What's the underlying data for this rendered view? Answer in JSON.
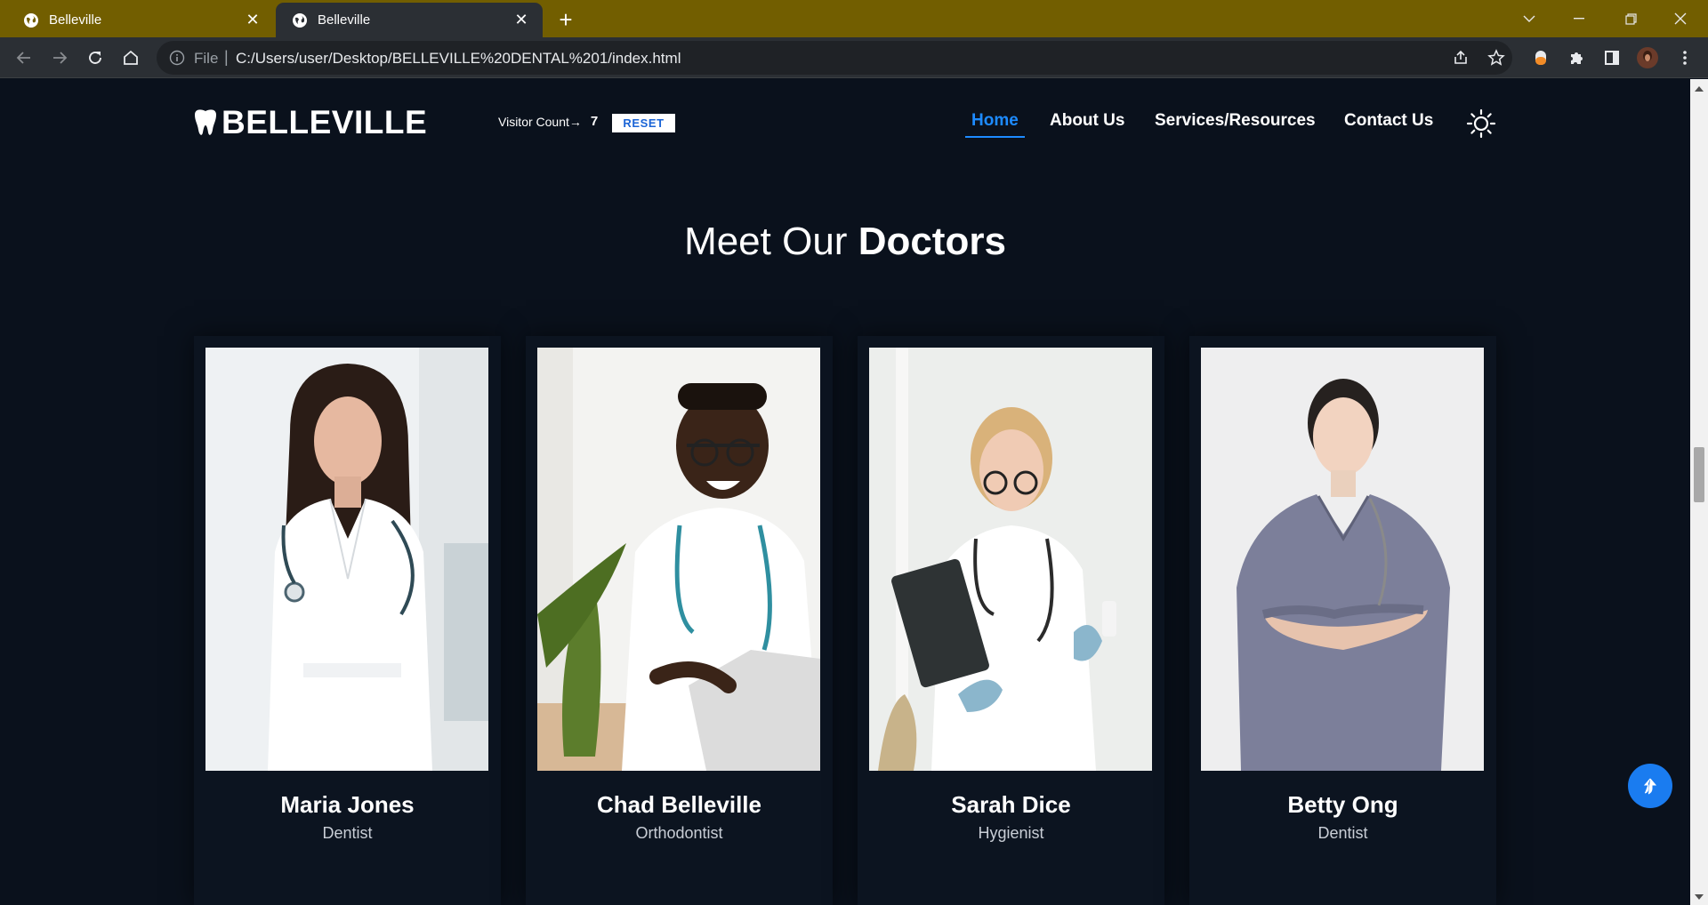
{
  "browser": {
    "tabs": [
      {
        "title": "Belleville",
        "active": false
      },
      {
        "title": "Belleville",
        "active": true
      }
    ],
    "address": {
      "scheme_label": "File",
      "url": "C:/Users/user/Desktop/BELLEVILLE%20DENTAL%201/index.html"
    }
  },
  "site": {
    "logo_text": "BELLEVILLE",
    "visitor_label": "Visitor Count→",
    "visitor_count": "7",
    "reset_label": "RESET",
    "nav": [
      {
        "label": "Home",
        "active": true
      },
      {
        "label": "About Us",
        "active": false
      },
      {
        "label": "Services/Resources",
        "active": false
      },
      {
        "label": "Contact Us",
        "active": false
      }
    ],
    "accent_color": "#1d8bff",
    "background_color": "#0a111c"
  },
  "section": {
    "title_light": "Meet Our",
    "title_bold": "Doctors"
  },
  "doctors": [
    {
      "name": "Maria Jones",
      "role": "Dentist"
    },
    {
      "name": "Chad Belleville",
      "role": "Orthodontist"
    },
    {
      "name": "Sarah Dice",
      "role": "Hygienist"
    },
    {
      "name": "Betty Ong",
      "role": "Dentist"
    }
  ],
  "icons": [
    "globe-icon",
    "close-icon",
    "plus-icon",
    "back-icon",
    "forward-icon",
    "reload-icon",
    "home-icon",
    "info-icon",
    "share-icon",
    "star-icon",
    "extensions-icon",
    "sidebar-icon",
    "profile-icon",
    "menu-icon",
    "tooth-icon",
    "sun-icon",
    "arrow-up-icon"
  ]
}
